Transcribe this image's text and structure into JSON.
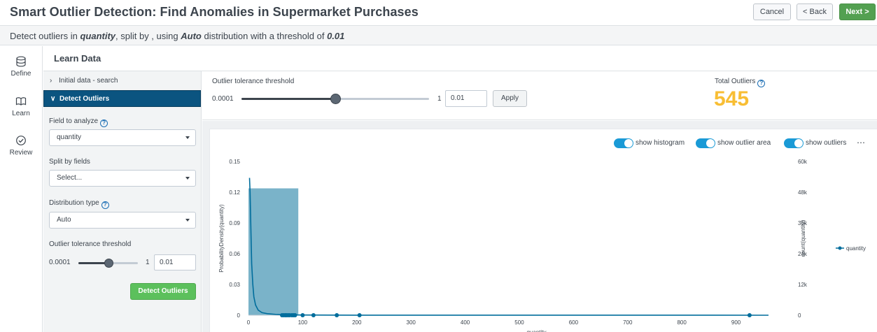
{
  "header": {
    "title": "Smart Outlier Detection: Find Anomalies in Supermarket Purchases",
    "cancel_label": "Cancel",
    "back_label": "< Back",
    "next_label": "Next >"
  },
  "summary": {
    "prefix": "Detect outliers in",
    "field": "quantity",
    "mid1": ", split by , using",
    "distribution": "Auto",
    "mid2": "distribution with a threshold of",
    "threshold": "0.01"
  },
  "nav": {
    "items": [
      {
        "label": "Define",
        "icon": "database-icon"
      },
      {
        "label": "Learn",
        "icon": "book-icon"
      },
      {
        "label": "Review",
        "icon": "check-circle-icon"
      }
    ]
  },
  "learn": {
    "title": "Learn Data",
    "accordion": [
      {
        "label": "Initial data - search",
        "expanded": false
      },
      {
        "label": "Detect Outliers",
        "expanded": true
      }
    ],
    "field_label": "Field to analyze",
    "field_value": "quantity",
    "split_label": "Split by fields",
    "split_placeholder": "Select...",
    "dist_label": "Distribution type",
    "dist_value": "Auto",
    "threshold_label": "Outlier tolerance threshold",
    "threshold_min": "0.0001",
    "threshold_max": "1",
    "threshold_value": "0.01",
    "threshold_level": 0.5,
    "detect_button": "Detect Outliers"
  },
  "controls": {
    "threshold_label": "Outlier tolerance threshold",
    "threshold_min": "0.0001",
    "threshold_max": "1",
    "threshold_value": "0.01",
    "threshold_level": 0.5,
    "apply_label": "Apply",
    "total_outliers_label": "Total Outliers",
    "total_outliers_value": "545",
    "accent": "#f8be34"
  },
  "chart_toggles": [
    {
      "label": "show histogram",
      "on": true
    },
    {
      "label": "show outlier area",
      "on": true
    },
    {
      "label": "show outliers",
      "on": true
    }
  ],
  "chart_data": {
    "type": "line",
    "xlabel": "quantity",
    "ylabel_left": "ProbabilityDensity(quantity)",
    "ylabel_right": "count(quantity)",
    "x_ticks": [
      "0",
      "100",
      "200",
      "300",
      "400",
      "500",
      "600",
      "700",
      "800",
      "900"
    ],
    "x_range": [
      0,
      960
    ],
    "y_left_ticks": [
      "0",
      "0.03",
      "0.06",
      "0.09",
      "0.12",
      "0.15"
    ],
    "y_left_range": [
      0,
      0.15
    ],
    "y_right_ticks": [
      "0",
      "12k",
      "24k",
      "36k",
      "48k",
      "60k"
    ],
    "y_right_range": [
      0,
      60000
    ],
    "legend": "quantity",
    "histogram": [
      {
        "x0": 0,
        "x1": 92,
        "count": 49500
      }
    ],
    "density": [
      [
        2,
        0.134
      ],
      [
        3,
        0.12
      ],
      [
        4,
        0.095
      ],
      [
        5,
        0.07
      ],
      [
        6,
        0.05
      ],
      [
        8,
        0.03
      ],
      [
        10,
        0.018
      ],
      [
        13,
        0.01
      ],
      [
        18,
        0.005
      ],
      [
        25,
        0.0025
      ],
      [
        35,
        0.0015
      ],
      [
        50,
        0.0008
      ],
      [
        70,
        0.0004
      ],
      [
        100,
        0.0002
      ],
      [
        200,
        0.0001
      ],
      [
        400,
        5e-05
      ],
      [
        960,
        2e-05
      ]
    ],
    "outliers": [
      62,
      65,
      68,
      70,
      73,
      76,
      80,
      83,
      86,
      100,
      120,
      163,
      205,
      925
    ],
    "series_color": "#006d9c",
    "histogram_color": "#7ab3c9"
  }
}
